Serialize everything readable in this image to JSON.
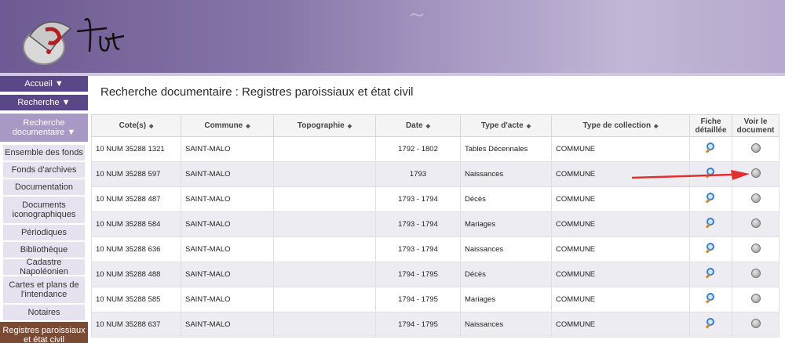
{
  "sidebar": {
    "accueil": "Accueil ▼",
    "recherche": "Recherche ▼",
    "recherche_doc": "Recherche documentaire ▼",
    "items": [
      "Ensemble des fonds",
      "Fonds d'archives",
      "Documentation",
      "Documents iconographiques",
      "Périodiques",
      "Bibliothèque",
      "Cadastre Napoléonien",
      "Cartes et plans de l'intendance",
      "Notaires",
      "Registres paroissiaux et état civil"
    ]
  },
  "page": {
    "title": "Recherche documentaire : Registres paroissiaux et état civil"
  },
  "table": {
    "headers": [
      "Cote(s)",
      "Commune",
      "Topographie",
      "Date",
      "Type d'acte",
      "Type de collection",
      "Fiche détaillée",
      "Voir le document"
    ],
    "sort_icon": "⬍",
    "rows": [
      [
        "10 NUM 35288 1321",
        "SAINT-MALO",
        "",
        "1792 - 1802",
        "Tables Décennales",
        "COMMUNE"
      ],
      [
        "10 NUM 35288 597",
        "SAINT-MALO",
        "",
        "1793",
        "Naissances",
        "COMMUNE"
      ],
      [
        "10 NUM 35288 487",
        "SAINT-MALO",
        "",
        "1793 - 1794",
        "Décès",
        "COMMUNE"
      ],
      [
        "10 NUM 35288 584",
        "SAINT-MALO",
        "",
        "1793 - 1794",
        "Mariages",
        "COMMUNE"
      ],
      [
        "10 NUM 35288 636",
        "SAINT-MALO",
        "",
        "1793 - 1794",
        "Naissances",
        "COMMUNE"
      ],
      [
        "10 NUM 35288 488",
        "SAINT-MALO",
        "",
        "1794 - 1795",
        "Décès",
        "COMMUNE"
      ],
      [
        "10 NUM 35288 585",
        "SAINT-MALO",
        "",
        "1794 - 1795",
        "Mariages",
        "COMMUNE"
      ],
      [
        "10 NUM 35288 637",
        "SAINT-MALO",
        "",
        "1794 - 1795",
        "Naissances",
        "COMMUNE"
      ]
    ]
  },
  "colors": {
    "banner": "#8676a8",
    "nav_main": "#5a4785",
    "nav_active": "#7b4a34",
    "arrow": "#e03030"
  },
  "icons": {
    "detail": "magnifier-icon",
    "view": "view-document-icon"
  }
}
